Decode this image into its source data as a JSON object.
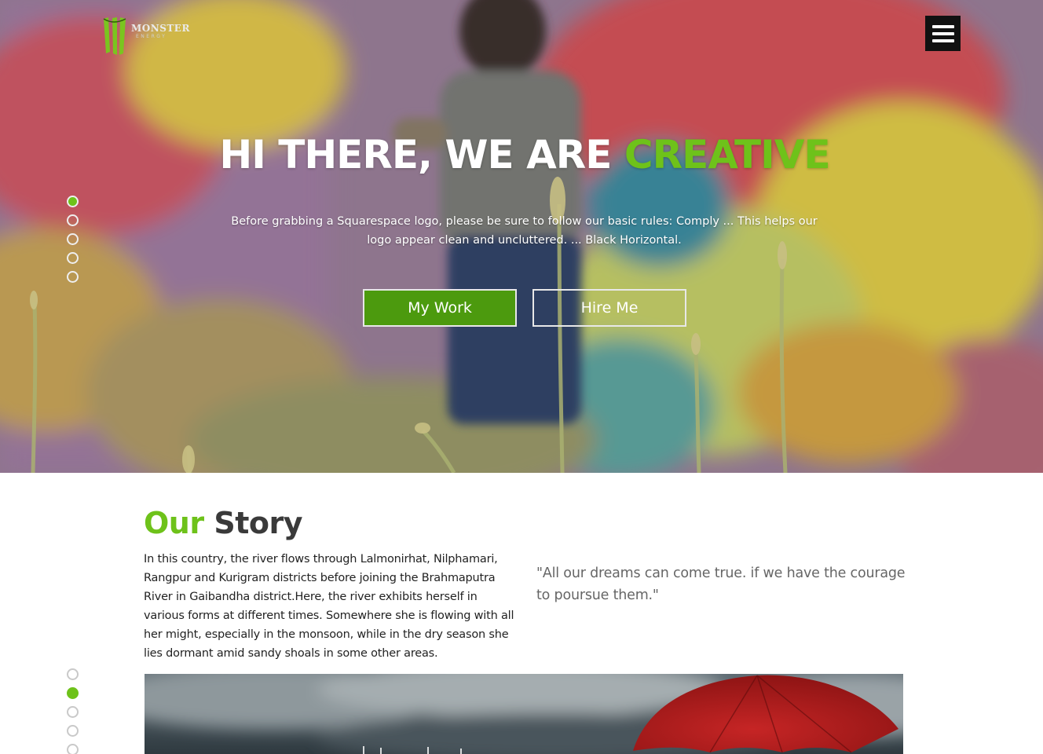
{
  "brand": {
    "name": "MONSTER",
    "sub": "ENERGY",
    "accent_color": "#6ec21a"
  },
  "header": {
    "menu_icon": "hamburger-icon"
  },
  "hero": {
    "title_main": "HI THERE, WE ARE ",
    "title_accent": "CREATIVE",
    "description": "Before grabbing a Squarespace logo, please be sure to follow our basic rules: Comply ... This helps our logo appear clean and uncluttered. ... Black Horizontal.",
    "buttons": {
      "my_work": "My Work",
      "hire_me": "Hire Me"
    },
    "slide_count": 5,
    "active_slide": 1
  },
  "story": {
    "title_accent": "Our",
    "title_main": "Story",
    "body": "In this country, the river flows through Lalmonirhat, Nilphamari, Rangpur and Kurigram districts before joining the Brahmaputra River in Gaibandha district.Here, the river exhibits herself in various forms at different times. Somewhere she is flowing with all her might, especially in the monsoon, while in the dry season she lies dormant amid sandy shoals in some other areas.",
    "quote": "\"All our dreams can come true. if we have the courage to poursue them.\"",
    "slide_count": 5,
    "active_slide": 2
  },
  "colors": {
    "accent": "#6ec21a",
    "button_green": "#4c9a0e",
    "menu_bg": "#111111"
  }
}
